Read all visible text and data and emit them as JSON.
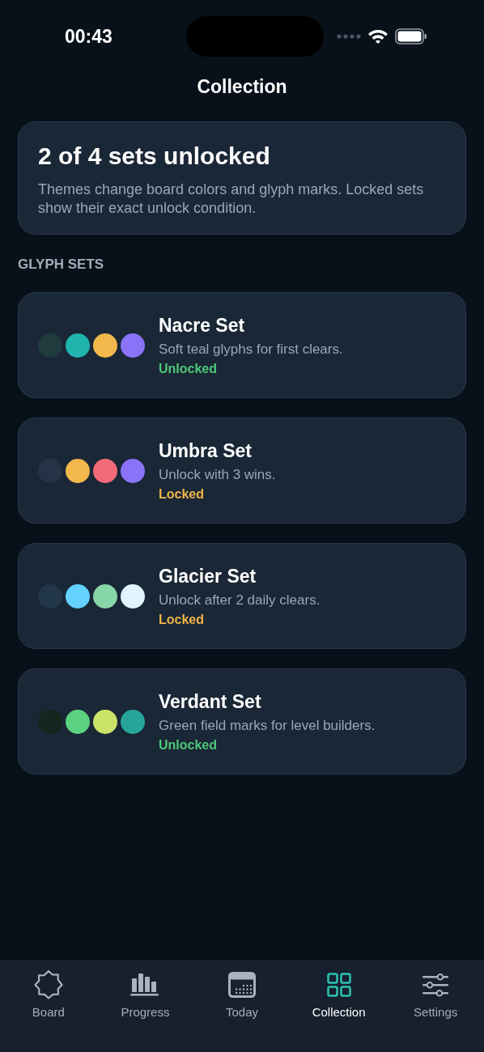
{
  "status_bar": {
    "time": "00:43"
  },
  "title": "Collection",
  "summary": {
    "heading": "2 of 4 sets unlocked",
    "text": "Themes change board colors and glyph marks. Locked sets show their exact unlock condition."
  },
  "section_label": "GLYPH SETS",
  "sets": [
    {
      "name": "Nacre Set",
      "description": "Soft teal glyphs for first clears.",
      "status": "Unlocked",
      "unlocked": true,
      "swatches": [
        {
          "color": "#1f3b3e"
        },
        {
          "color": "#1fb5ad"
        },
        {
          "color": "#f2b84b"
        },
        {
          "color": "#8b73f7"
        }
      ]
    },
    {
      "name": "Umbra Set",
      "description": "Unlock with 3 wins.",
      "status": "Locked",
      "unlocked": false,
      "swatches": [
        {
          "color": "#253346"
        },
        {
          "color": "#f2b84b"
        },
        {
          "color": "#f26b7a"
        },
        {
          "color": "#8b73f7"
        }
      ]
    },
    {
      "name": "Glacier Set",
      "description": "Unlock after 2 daily clears.",
      "status": "Locked",
      "unlocked": false,
      "swatches": [
        {
          "color": "#22364a"
        },
        {
          "color": "#63d2ff"
        },
        {
          "color": "#86d6a8"
        },
        {
          "color": "#e0f4ff"
        }
      ]
    },
    {
      "name": "Verdant Set",
      "description": "Green field marks for level builders.",
      "status": "Unlocked",
      "unlocked": true,
      "swatches": [
        {
          "color": "#14261d"
        },
        {
          "color": "#5cd17f"
        },
        {
          "color": "#cce36a"
        },
        {
          "color": "#26a69a"
        }
      ]
    }
  ],
  "tabs": [
    {
      "label": "Board",
      "kind": "board",
      "selected": false
    },
    {
      "label": "Progress",
      "kind": "progress",
      "selected": false
    },
    {
      "label": "Today",
      "kind": "today",
      "selected": false
    },
    {
      "label": "Collection",
      "kind": "collection",
      "selected": true
    },
    {
      "label": "Settings",
      "kind": "settings",
      "selected": false
    }
  ]
}
